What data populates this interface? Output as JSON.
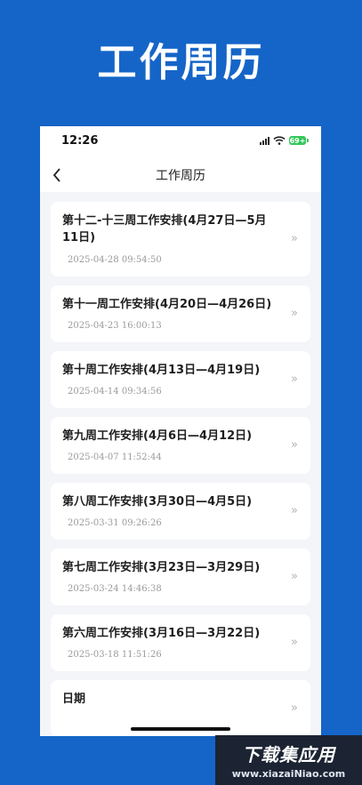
{
  "hero": {
    "title": "工作周历"
  },
  "status_bar": {
    "time": "12:26",
    "battery": "69+"
  },
  "nav": {
    "title": "工作周历"
  },
  "items": [
    {
      "title": "第十二-十三周工作安排(4月27日—5月11日)",
      "date": "2025-04-28 09:54:50"
    },
    {
      "title": "第十一周工作安排(4月20日—4月26日)",
      "date": "2025-04-23 16:00:13"
    },
    {
      "title": "第十周工作安排(4月13日—4月19日)",
      "date": "2025-04-14 09:34:56"
    },
    {
      "title": "第九周工作安排(4月6日—4月12日)",
      "date": "2025-04-07 11:52:44"
    },
    {
      "title": "第八周工作安排(3月30日—4月5日)",
      "date": "2025-03-31 09:26:26"
    },
    {
      "title": "第七周工作安排(3月23日—3月29日)",
      "date": "2025-03-24 14:46:38"
    },
    {
      "title": "第六周工作安排(3月16日—3月22日)",
      "date": "2025-03-18 11:51:26"
    },
    {
      "title": "日期",
      "date": ""
    }
  ],
  "chevron": "»",
  "watermark": {
    "main": "下载集应用",
    "url": "www.xiazaiNiao.com"
  },
  "colors": {
    "background": "#1565c8",
    "accent_green": "#34c759"
  }
}
